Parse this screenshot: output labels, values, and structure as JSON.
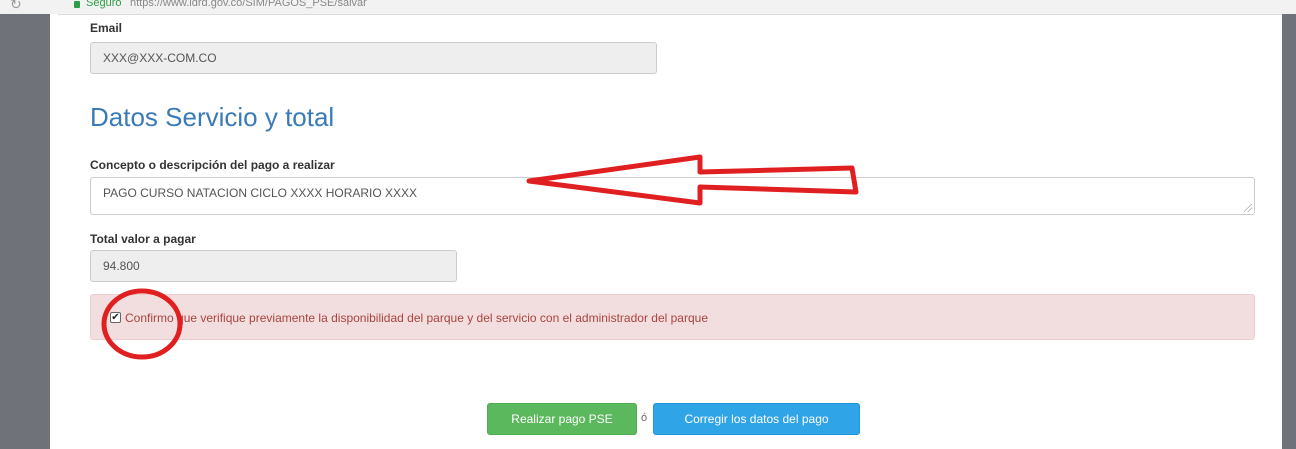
{
  "browser": {
    "secure_label": "Seguro",
    "url": "https://www.idrd.gov.co/SIM/PAGOS_PSE/salvar"
  },
  "form": {
    "email": {
      "label": "Email",
      "value": "XXX@XXX-COM.CO"
    },
    "section_title": "Datos Servicio y total",
    "concept": {
      "label": "Concepto o descripción del pago a realizar",
      "value": "PAGO CURSO NATACION CICLO XXXX HORARIO XXXX"
    },
    "total": {
      "label": "Total valor a pagar",
      "value": "94.800"
    },
    "confirm": {
      "checked": true,
      "check_mark": "✔",
      "text": "Confirmo que verifique previamente la disponibilidad del parque y del servicio con el administrador del parque"
    }
  },
  "actions": {
    "pay_label": "Realizar pago PSE",
    "separator": "ó",
    "correct_label": "Corregir los datos del pago"
  },
  "colors": {
    "title_blue": "#3a7ab6",
    "alert_bg": "#f2dede",
    "alert_text": "#a94442",
    "pay_green": "#5cb85c",
    "correct_blue": "#2fa4e7",
    "annotation_red": "#e02020"
  }
}
